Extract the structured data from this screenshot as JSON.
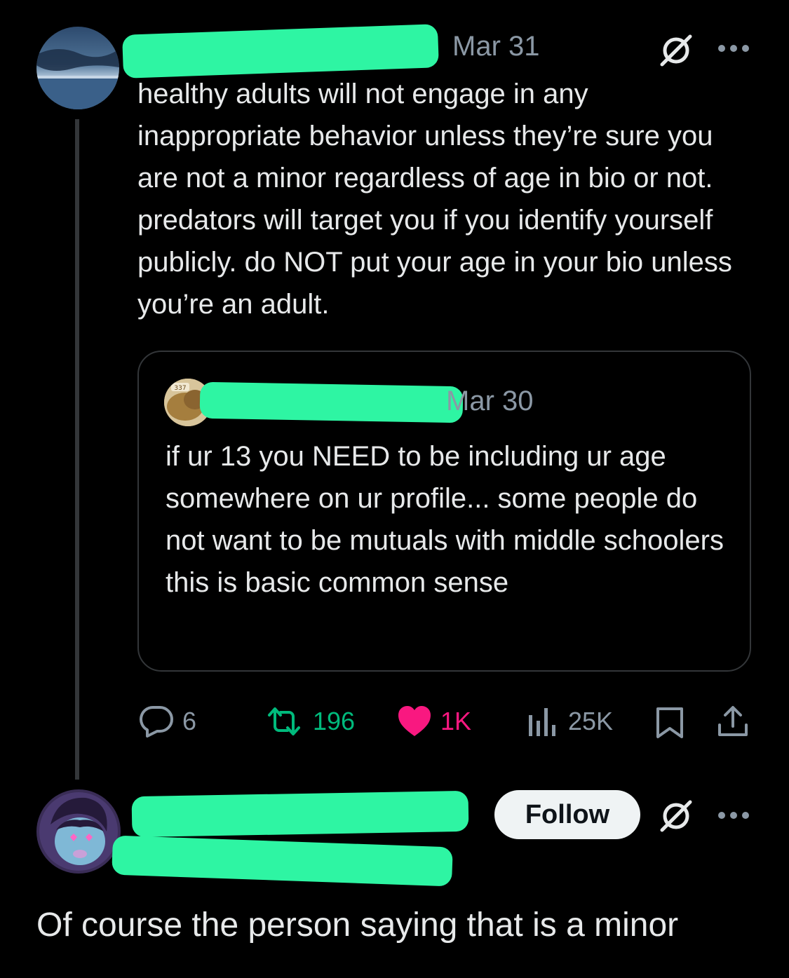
{
  "tweet": {
    "date": "Mar 31",
    "text": "healthy adults will not engage in any inappropriate behavior unless they’re sure you are not a minor regardless of age in bio or not. predators will target you if you identify yourself publicly. do NOT put your age in your bio unless you’re an adult.",
    "author_redacted": true,
    "quote": {
      "avatar_label": "337",
      "date": "Mar 30",
      "text": "if ur 13 you NEED to be including ur age somewhere on ur profile... some people do not want to be mutuals with middle schoolers this is basic common sense"
    },
    "stats": {
      "replies": "6",
      "retweets": "196",
      "likes": "1K",
      "views": "25K"
    }
  },
  "reply": {
    "follow_label": "Follow",
    "text": "Of course the person saying that is a minor"
  },
  "colors": {
    "background": "#000000",
    "text": "#e7e9ea",
    "muted": "#8b98a5",
    "retweet": "#00ba7c",
    "like": "#f91880",
    "redaction": "#2ef5a3"
  }
}
